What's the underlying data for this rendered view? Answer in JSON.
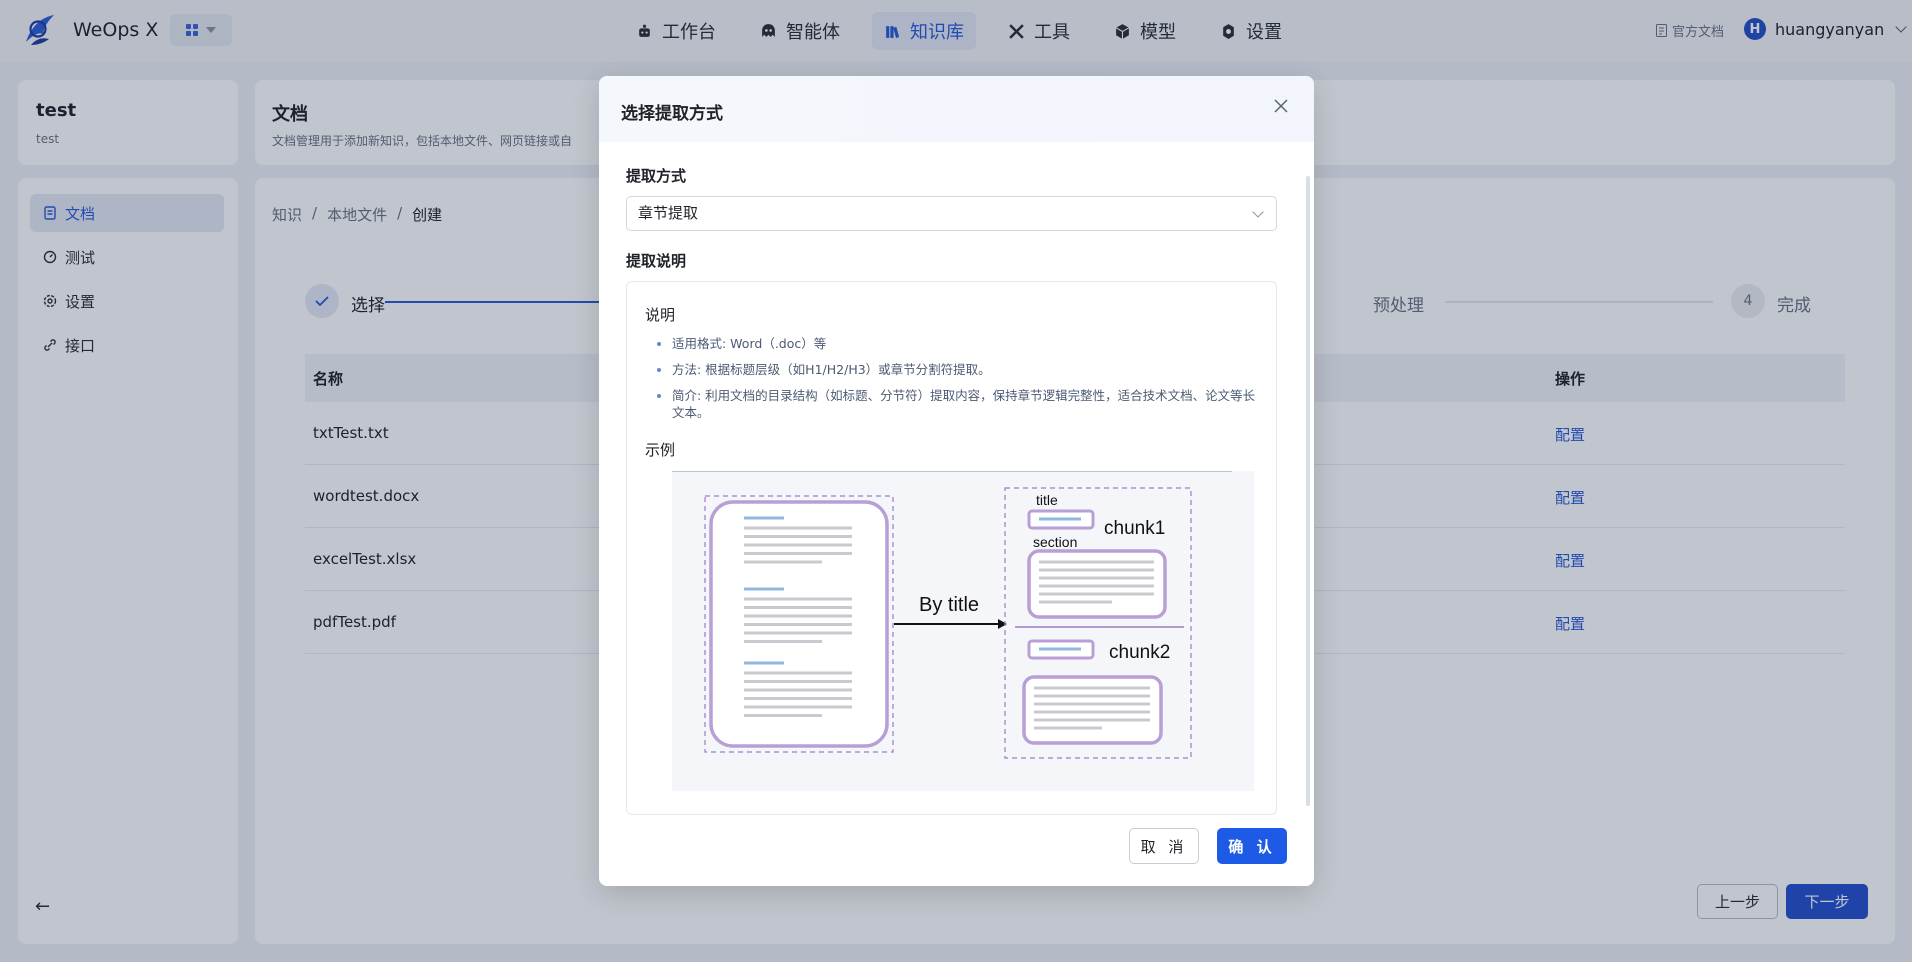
{
  "app": {
    "name": "WeOps X"
  },
  "nav": {
    "items": [
      {
        "label": "工作台"
      },
      {
        "label": "智能体"
      },
      {
        "label": "知识库"
      },
      {
        "label": "工具"
      },
      {
        "label": "模型"
      },
      {
        "label": "设置"
      }
    ],
    "active": "知识库",
    "doc_link": "官方文档",
    "user_name": "huangyanyan",
    "user_initial": "H"
  },
  "knowledge_base": {
    "title": "test",
    "subtitle": "test"
  },
  "sidebar": {
    "items": [
      {
        "label": "文档",
        "icon": "document-icon"
      },
      {
        "label": "测试",
        "icon": "test-icon"
      },
      {
        "label": "设置",
        "icon": "gear-icon"
      },
      {
        "label": "接口",
        "icon": "link-icon"
      }
    ],
    "active": "文档"
  },
  "page": {
    "title": "文档",
    "description": "文档管理用于添加新知识，包括本地文件、网页链接或自",
    "breadcrumb": [
      "知识",
      "本地文件",
      "创建"
    ]
  },
  "steps": [
    {
      "label": "选择",
      "status": "done"
    },
    {
      "label": "预处理",
      "status": "pending"
    },
    {
      "label": "完成",
      "number": "4",
      "status": "pending"
    }
  ],
  "table": {
    "columns": {
      "name": "名称",
      "action": "操作"
    },
    "rows": [
      {
        "name": "txtTest.txt",
        "action": "配置"
      },
      {
        "name": "wordtest.docx",
        "action": "配置"
      },
      {
        "name": "excelTest.xlsx",
        "action": "配置"
      },
      {
        "name": "pdfTest.pdf",
        "action": "配置"
      }
    ]
  },
  "buttons": {
    "prev": "上一步",
    "next": "下一步"
  },
  "modal": {
    "title": "选择提取方式",
    "method_label": "提取方式",
    "method_value": "章节提取",
    "description_label": "提取说明",
    "desc_heading": "说明",
    "desc_items": [
      "适用格式: Word（.doc）等",
      "方法: 根据标题层级（如H1/H2/H3）或章节分割符提取。",
      "简介: 利用文档的目录结构（如标题、分节符）提取内容，保持章节逻辑完整性，适合技术文档、论文等长文本。"
    ],
    "example_heading": "示例",
    "diagram": {
      "arrow_label": "By title",
      "title_label": "title",
      "section_label": "section",
      "chunk1": "chunk1",
      "chunk2": "chunk2"
    },
    "cancel": "取 消",
    "confirm": "确 认"
  },
  "colors": {
    "primary": "#1d5be6",
    "nav_active": "#2a5bd7",
    "diagram_purple": "#b39bd1",
    "diagram_blue": "#8fb9dd"
  }
}
